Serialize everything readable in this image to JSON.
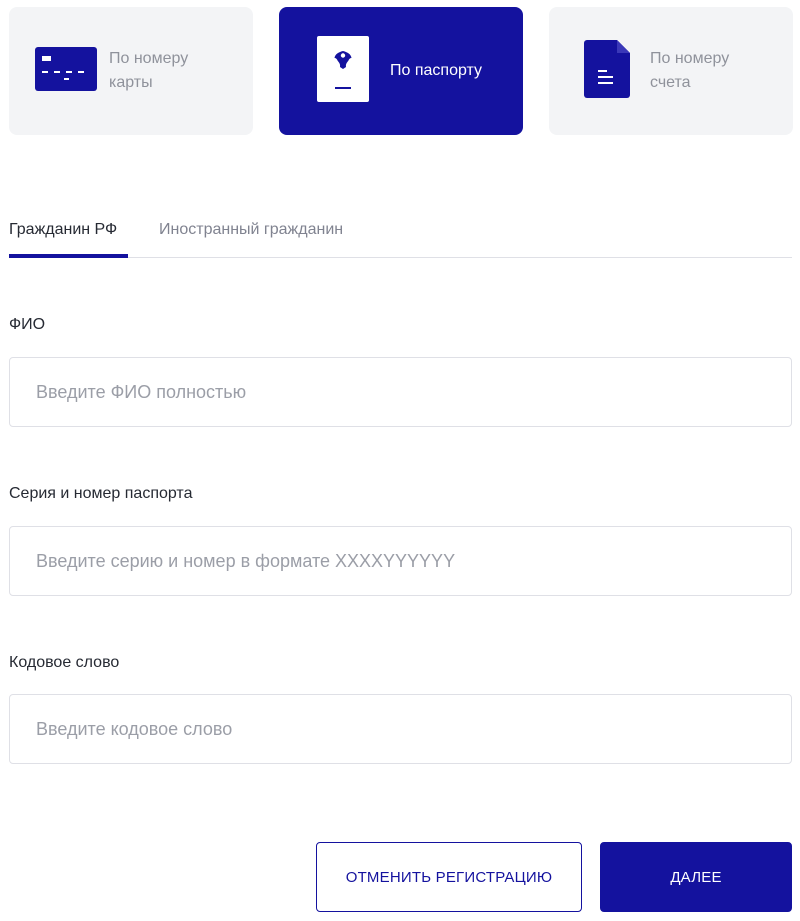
{
  "colors": {
    "accent": "#14129e",
    "card_bg": "#f3f4f6",
    "card_text": "#8f929b",
    "border": "#dfe0e6",
    "placeholder": "#9b9ea7"
  },
  "methods": {
    "card": {
      "icon": "bank-card-icon",
      "label_line1": "По номеру",
      "label_line2": "карты"
    },
    "passport": {
      "icon": "passport-icon",
      "label": "По паспорту",
      "active": true
    },
    "account": {
      "icon": "document-icon",
      "label_line1": "По номеру",
      "label_line2": "счета"
    }
  },
  "tabs": {
    "citizen": "Гражданин РФ",
    "foreign": "Иностранный гражданин"
  },
  "form": {
    "fio": {
      "label": "ФИО",
      "placeholder": "Введите ФИО полностью",
      "value": ""
    },
    "passport": {
      "label": "Серия и номер паспорта",
      "placeholder": "Введите серию и номер в формате XXXXYYYYYY",
      "value": ""
    },
    "codeword": {
      "label": "Кодовое слово",
      "placeholder": "Введите кодовое слово",
      "value": ""
    }
  },
  "buttons": {
    "cancel": "ОТМЕНИТЬ РЕГИСТРАЦИЮ",
    "next": "ДАЛЕЕ"
  }
}
